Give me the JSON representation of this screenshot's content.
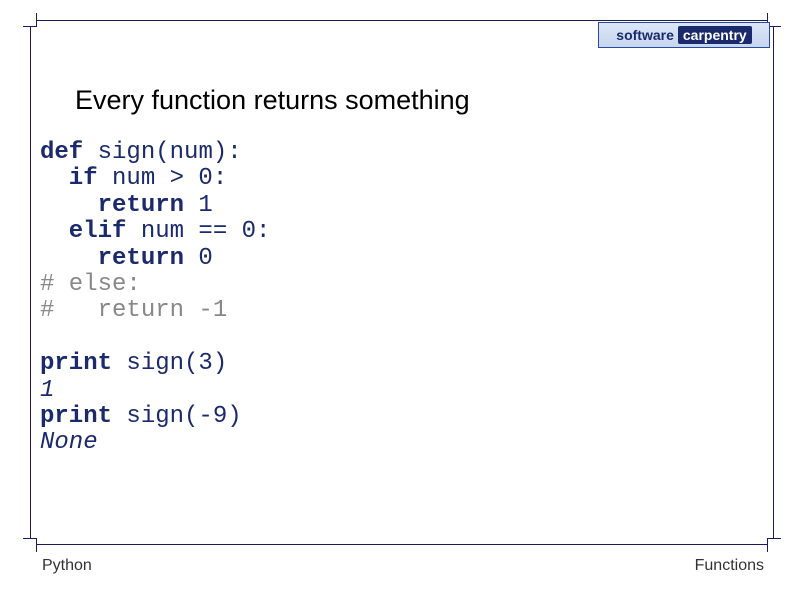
{
  "logo": {
    "left": "software",
    "right": "carpentry"
  },
  "title": "Every function returns something",
  "code": {
    "l1a": "def",
    "l1b": " sign(num):",
    "l2a": "  if",
    "l2b": " num > 0:",
    "l3a": "    return",
    "l3b": " 1",
    "l4a": "  elif",
    "l4b": " num == 0:",
    "l5a": "    return",
    "l5b": " 0",
    "l6": "# else:",
    "l7": "#   return -1",
    "l9a": "print",
    "l9b": " sign(3)",
    "l10": "1",
    "l11a": "print",
    "l11b": " sign(-9)",
    "l12": "None"
  },
  "footer": {
    "left": "Python",
    "right": "Functions"
  }
}
